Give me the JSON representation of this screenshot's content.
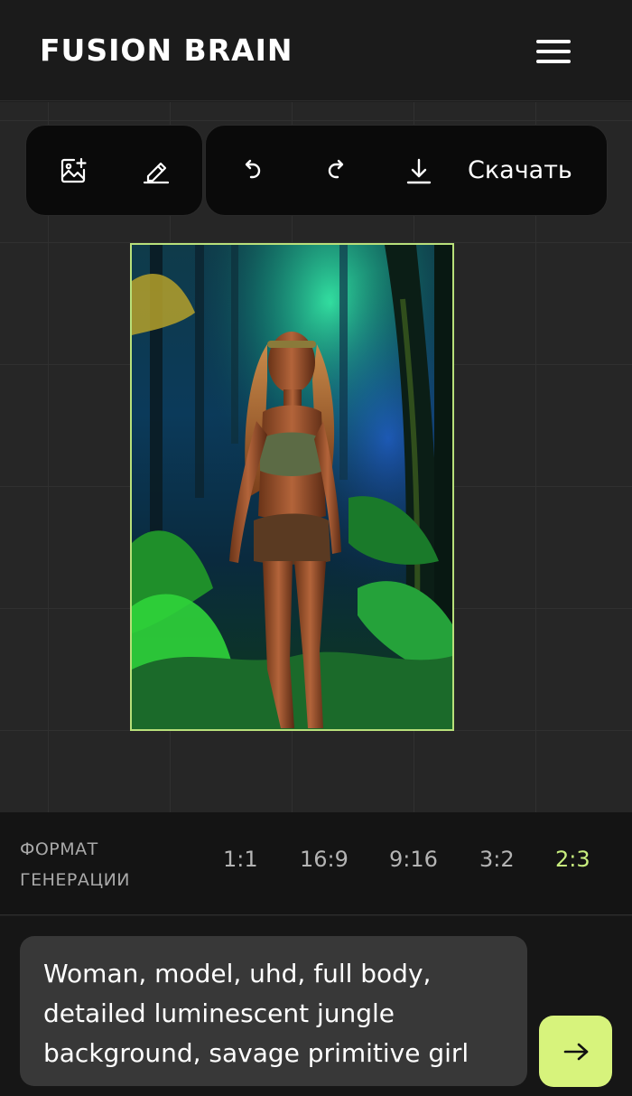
{
  "header": {
    "logo": "FUSION BRAIN",
    "menu_icon": "hamburger-menu-icon"
  },
  "toolbar": {
    "left_group": [
      {
        "icon": "add-image-icon"
      },
      {
        "icon": "eraser-edit-icon"
      }
    ],
    "right_group": [
      {
        "icon": "undo-icon"
      },
      {
        "icon": "redo-icon"
      },
      {
        "icon": "download-icon"
      }
    ],
    "download_label": "Скачать"
  },
  "image": {
    "description_icon": "generated-image"
  },
  "format": {
    "label_line1": "ФОРМАТ",
    "label_line2": "ГЕНЕРАЦИИ",
    "options": [
      "1:1",
      "16:9",
      "9:16",
      "3:2",
      "2:3"
    ],
    "selected": "2:3"
  },
  "prompt": {
    "value": "Woman, model, uhd, full body, detailed luminescent jungle background, savage primitive girl"
  },
  "colors": {
    "accent": "#d7f37c",
    "selected_ratio": "#c8ee7e",
    "frame_border": "#b8e07a"
  }
}
